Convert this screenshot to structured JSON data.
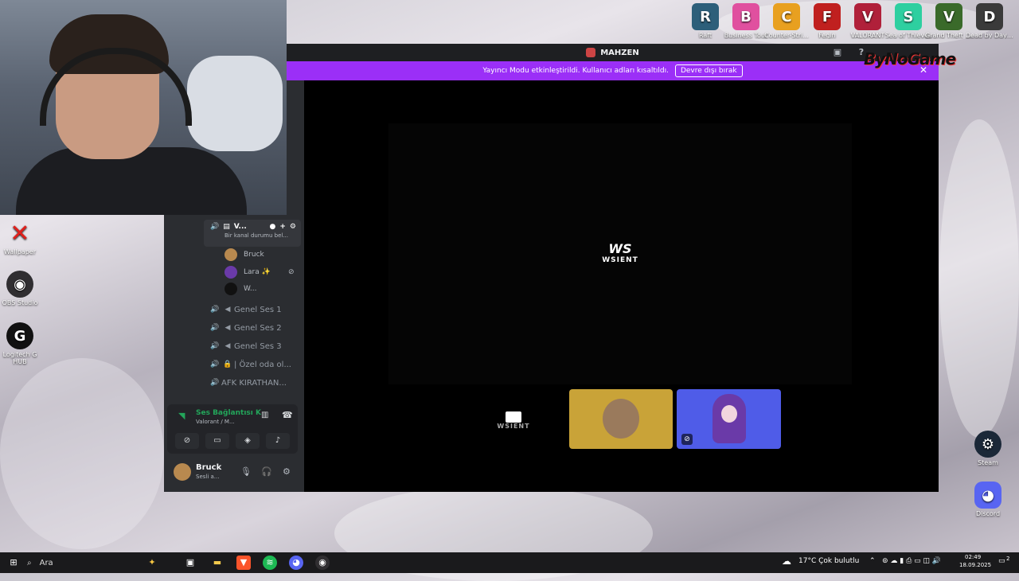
{
  "desktop": {
    "left_icons": [
      {
        "label": "Wallpaper",
        "icon": "close-x-icon"
      },
      {
        "label": "OBS Studio",
        "icon": "obs-icon"
      },
      {
        "label": "Logitech G HUB",
        "icon": "logitech-icon"
      }
    ],
    "top_icons": [
      {
        "label": "Raft",
        "icon": "raft-icon",
        "color": "#2d5f7a",
        "glyph": "R"
      },
      {
        "label": "Business Tour",
        "icon": "business-tour-icon",
        "color": "#e0509f",
        "glyph": "B"
      },
      {
        "label": "Counter-Stri...",
        "icon": "counter-strike-icon",
        "color": "#e8a020",
        "glyph": "C"
      },
      {
        "label": "Fegin",
        "icon": "fegin-icon",
        "color": "#c0201f",
        "glyph": "F"
      },
      {
        "label": "VALORANT",
        "icon": "valorant-icon",
        "color": "#b0203a",
        "glyph": "V"
      },
      {
        "label": "Sea of Thieves",
        "icon": "sea-of-thieves-icon",
        "color": "#2ecfa0",
        "glyph": "S"
      },
      {
        "label": "Grand Theft Auto V Le...",
        "icon": "gta-icon",
        "color": "#3a6a2a",
        "glyph": "V"
      },
      {
        "label": "Dead by Daylight",
        "icon": "dead-by-daylight-icon",
        "color": "#3a3a3a",
        "glyph": "D"
      }
    ],
    "right_icons": [
      {
        "label": "Steam",
        "icon": "steam-icon"
      },
      {
        "label": "Discord",
        "icon": "discord-icon"
      }
    ]
  },
  "window": {
    "title": "MAHZEN",
    "banner_text": "Yayıncı Modu etkinleştirildi. Kullanıcı adları kısaltıldı.",
    "banner_button": "Devre dışı bırak",
    "overlay_brand": "ByNoGame"
  },
  "stage": {
    "logo_mark": "WS",
    "logo_text": "WSIENT"
  },
  "tiles": {
    "tile1_text": "WSIENT"
  },
  "channels": {
    "header_title": "V...",
    "header_sub": "Bir kanal durumu bel...",
    "voice_users": [
      "Bruck",
      "Lara ✨",
      "W..."
    ],
    "list": [
      {
        "name": "Genel Ses 1",
        "locked": false
      },
      {
        "name": "Genel Ses 2",
        "locked": false
      },
      {
        "name": "Genel Ses 3",
        "locked": false
      },
      {
        "name": "| Özel oda ol...",
        "locked": true
      },
      {
        "name": "AFK KIRATHAN...",
        "locked": false
      }
    ]
  },
  "voice_panel": {
    "status": "Ses Bağlantısı K",
    "location": "Valorant / M..."
  },
  "user": {
    "name": "Bruck",
    "status": "Sesli a..."
  },
  "taskbar": {
    "search_placeholder": "Ara",
    "weather": "17°C  Çok bulutlu",
    "time": "02:49",
    "date": "18.09.2025",
    "notif_count": "2"
  }
}
